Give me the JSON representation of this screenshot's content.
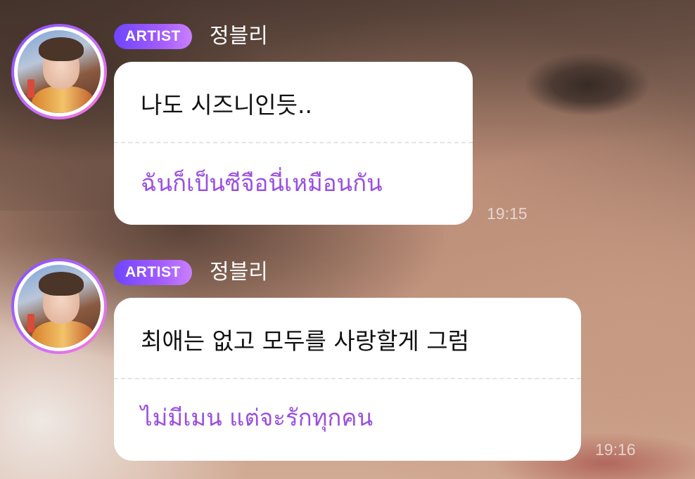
{
  "messages": [
    {
      "badge": "ARTIST",
      "sender": "정블리",
      "text": "나도 시즈니인듯..",
      "translation": "ฉันก็เป็นซีจือนี่เหมือนกัน",
      "time": "19:15"
    },
    {
      "badge": "ARTIST",
      "sender": "정블리",
      "text": "최애는 없고 모두를 사랑할게 그럼",
      "translation": "ไม่มีเมน แต่จะรักทุกคน",
      "time": "19:16"
    }
  ],
  "colors": {
    "badge_gradient": [
      "#6f45ff",
      "#c980ff"
    ],
    "translation_text": "#9a4fe0",
    "bubble_bg": "#ffffff"
  }
}
